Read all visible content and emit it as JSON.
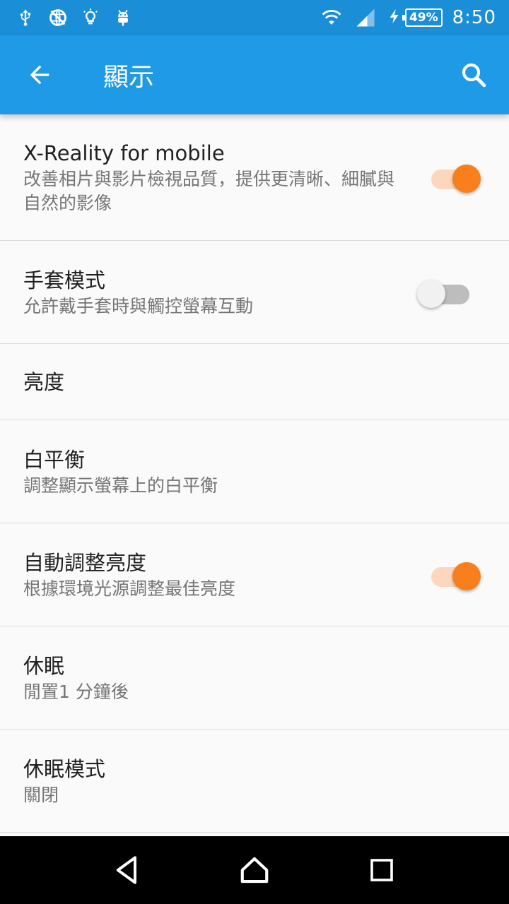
{
  "status_bar": {
    "battery_percent": "49%",
    "time": "8:50"
  },
  "app_bar": {
    "title": "顯示"
  },
  "settings": [
    {
      "title": "X-Reality for mobile",
      "summary": "改善相片與影片檢視品質，提供更清晰、細膩與自然的影像",
      "toggle": "on"
    },
    {
      "title": "手套模式",
      "summary": "允許戴手套時與觸控螢幕互動",
      "toggle": "off"
    },
    {
      "title": "亮度",
      "summary": ""
    },
    {
      "title": "白平衡",
      "summary": "調整顯示螢幕上的白平衡"
    },
    {
      "title": "自動調整亮度",
      "summary": "根據環境光源調整最佳亮度",
      "toggle": "on"
    },
    {
      "title": "休眠",
      "summary": "閒置1 分鐘後"
    },
    {
      "title": "休眠模式",
      "summary": "關閉"
    }
  ],
  "colors": {
    "status_bar": "#1a8fd8",
    "app_bar": "#1f9ae6",
    "toggle_on": "#f97f1d",
    "toggle_on_track": "#fcd7bd"
  }
}
